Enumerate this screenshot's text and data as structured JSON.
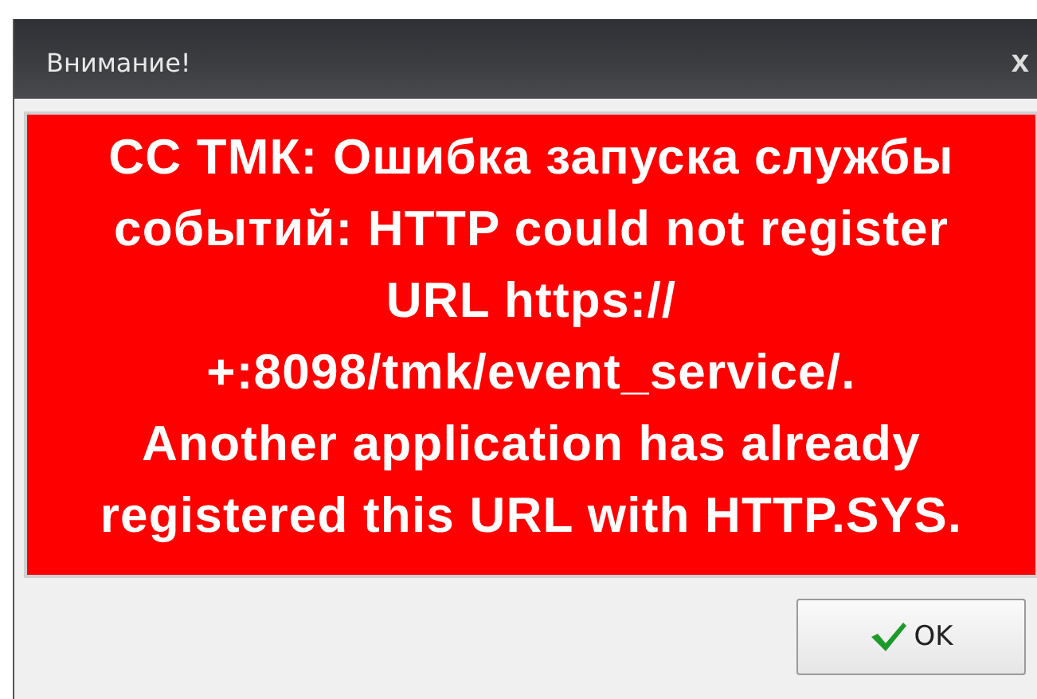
{
  "window": {
    "title": "Внимание!",
    "close": "x"
  },
  "message_lines": [
    "СС ТМК: Ошибка запуска службы",
    "событий: HTTP could not register",
    "URL https://",
    "+:8098/tmk/event_service/.",
    "Another application has already",
    "registered this URL with HTTP.SYS."
  ],
  "buttons": [
    {
      "label": "OK",
      "kind": "ok"
    }
  ]
}
